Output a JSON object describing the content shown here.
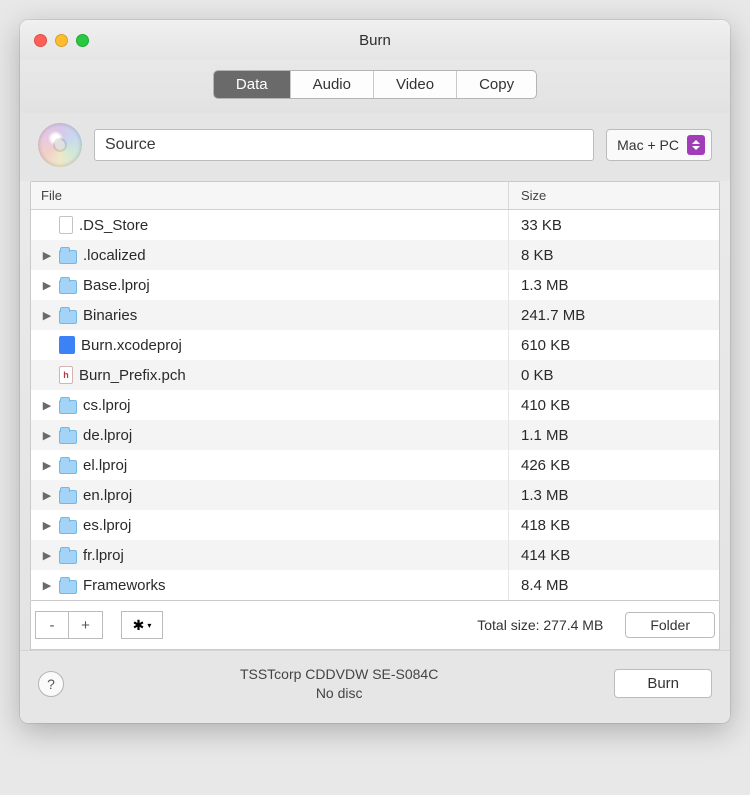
{
  "window": {
    "title": "Burn"
  },
  "tabs": {
    "items": [
      "Data",
      "Audio",
      "Video",
      "Copy"
    ],
    "active_index": 0
  },
  "toolbar": {
    "disc_name": "Source",
    "format_selected": "Mac + PC"
  },
  "table": {
    "headers": {
      "file": "File",
      "size": "Size"
    },
    "rows": [
      {
        "name": ".DS_Store",
        "size": "33 KB",
        "expandable": false,
        "icon": "doc"
      },
      {
        "name": ".localized",
        "size": "8 KB",
        "expandable": true,
        "icon": "folder"
      },
      {
        "name": "Base.lproj",
        "size": "1.3 MB",
        "expandable": true,
        "icon": "folder"
      },
      {
        "name": "Binaries",
        "size": "241.7 MB",
        "expandable": true,
        "icon": "folder"
      },
      {
        "name": "Burn.xcodeproj",
        "size": "610 KB",
        "expandable": false,
        "icon": "blue"
      },
      {
        "name": "Burn_Prefix.pch",
        "size": "0 KB",
        "expandable": false,
        "icon": "pch"
      },
      {
        "name": "cs.lproj",
        "size": "410 KB",
        "expandable": true,
        "icon": "folder"
      },
      {
        "name": "de.lproj",
        "size": "1.1 MB",
        "expandable": true,
        "icon": "folder"
      },
      {
        "name": "el.lproj",
        "size": "426 KB",
        "expandable": true,
        "icon": "folder"
      },
      {
        "name": "en.lproj",
        "size": "1.3 MB",
        "expandable": true,
        "icon": "folder"
      },
      {
        "name": "es.lproj",
        "size": "418 KB",
        "expandable": true,
        "icon": "folder"
      },
      {
        "name": "fr.lproj",
        "size": "414 KB",
        "expandable": true,
        "icon": "folder"
      },
      {
        "name": "Frameworks",
        "size": "8.4 MB",
        "expandable": true,
        "icon": "folder"
      }
    ]
  },
  "footer": {
    "total_label": "Total size: 277.4 MB",
    "folder_button": "Folder",
    "remove_label": "-",
    "add_label": "+"
  },
  "burn_row": {
    "help_label": "?",
    "device_line1": "TSSTcorp CDDVDW SE-S084C",
    "device_line2": "No disc",
    "burn_button": "Burn"
  }
}
